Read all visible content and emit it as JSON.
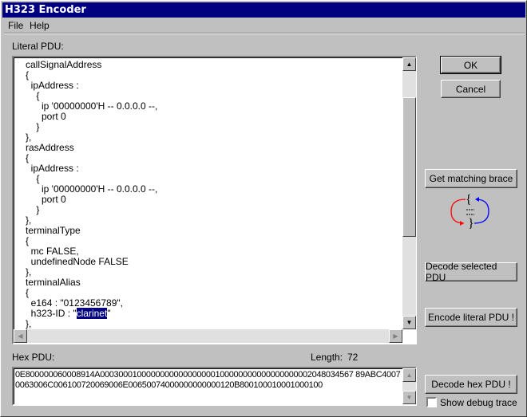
{
  "window": {
    "title": "H323 Encoder"
  },
  "menu": [
    "File",
    "Help"
  ],
  "literal": {
    "label": "Literal PDU:",
    "lines": [
      "callSignalAddress",
      "{",
      "  ipAddress :",
      "    {",
      "      ip '00000000'H -- 0.0.0.0 --,",
      "      port 0",
      "    }",
      "},",
      "rasAddress",
      "{",
      "  ipAddress :",
      "    {",
      "      ip '00000000'H -- 0.0.0.0 --,",
      "      port 0",
      "    }",
      "},",
      "terminalType",
      "{",
      "  mc FALSE,",
      "  undefinedNode FALSE",
      "},",
      "terminalAlias",
      "{",
      "  e164 : \"0123456789\",",
      "  h323-ID : \"",
      "},"
    ],
    "selected_text": "clarinet",
    "after_selected": "\""
  },
  "hex": {
    "label": "Hex PDU:",
    "length_label": "Length:",
    "length_value": "72",
    "lines": [
      "0E800000060008914A0003000100000000000000000100000000000000000002048034567 89ABC4007",
      "0063006C006100720069006E00650074000000000000120B800100010001000100"
    ]
  },
  "buttons": {
    "ok": "OK",
    "cancel": "Cancel",
    "brace": "Get matching brace",
    "decode_selected": "Decode selected PDU",
    "encode_literal": "Encode literal PDU !",
    "decode_hex": "Decode hex PDU !"
  },
  "debug": {
    "label": "Show debug trace",
    "checked": false
  },
  "colors": {
    "titlebar": "#000080",
    "selection": "#000080",
    "brace_arrow_left": "#ff0000",
    "brace_arrow_right": "#0000ff"
  }
}
